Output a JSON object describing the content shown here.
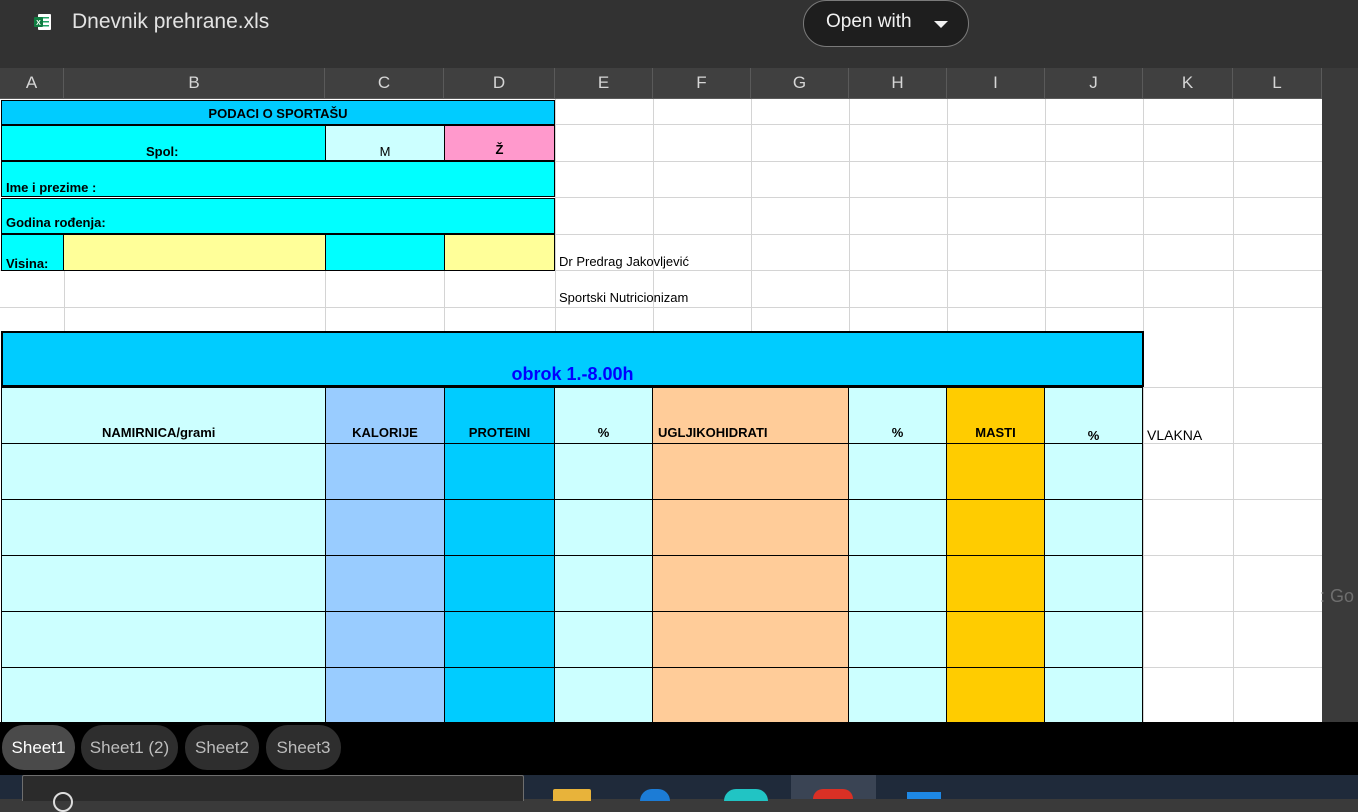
{
  "header": {
    "file_title": "Dnevnik prehrane.xls",
    "open_with": "Open with",
    "file_icon": "excel-file-icon"
  },
  "columns": [
    "A",
    "B",
    "C",
    "D",
    "E",
    "F",
    "G",
    "H",
    "I",
    "J",
    "K",
    "L"
  ],
  "cells": {
    "podaci": "PODACI O SPORTAŠU",
    "spol": "Spol:",
    "m": "M",
    "z": "Ž",
    "ime": "Ime i prezime :",
    "godina": "Godina rođenja:",
    "visina": "Visina:",
    "doctor": "Dr Predrag Jakovljević",
    "nutri": "Sportski Nutricionizam",
    "obrok": "obrok 1.-8.00h",
    "namirnica": "NAMIRNICA/grami",
    "kalorije": "KALORIJE",
    "proteini": "PROTEINI",
    "pct1": "%",
    "uglji": "UGLJIKOHIDRATI",
    "pct2": "%",
    "masti": "MASTI",
    "pct3": "%",
    "vlakna": "VLAKNA"
  },
  "ghost_text": ": Go",
  "tabs": [
    "Sheet1",
    "Sheet1 (2)",
    "Sheet2",
    "Sheet3"
  ],
  "active_tab": "Sheet1",
  "colors": {
    "cyan": "#00ffff",
    "header_blue": "#00ccff",
    "light_cyan": "#ccffff",
    "pink": "#ff99cc",
    "yellow": "#ffff99",
    "kalorije": "#99ccff",
    "uglji": "#ffcc99",
    "masti": "#ffcc00",
    "obrok_text": "#0000ff"
  },
  "taskbar_icons": [
    "search-icon",
    "file-explorer-icon",
    "edge-icon",
    "chrome-icon",
    "app-icon",
    "app-icon-2"
  ]
}
